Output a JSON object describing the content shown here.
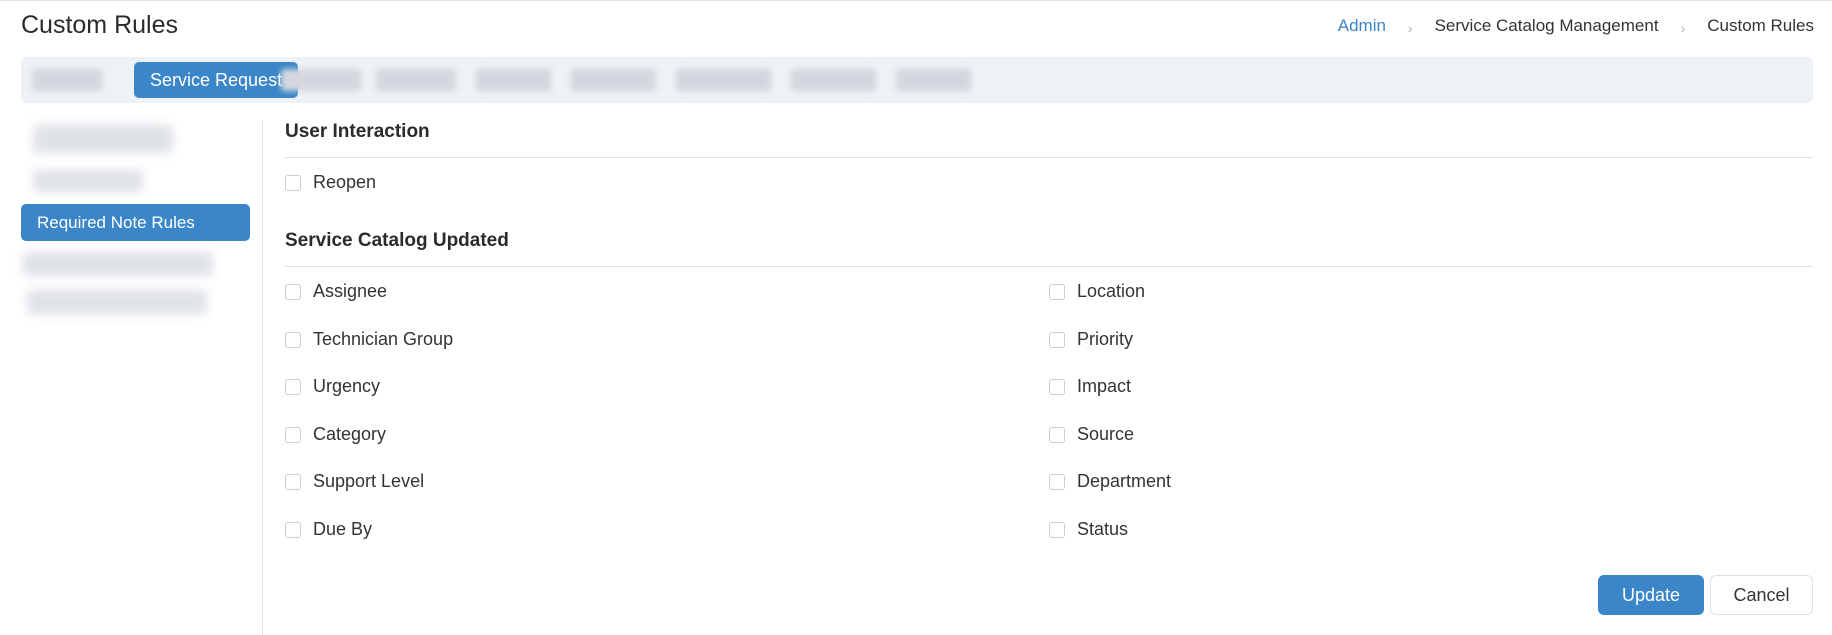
{
  "header": {
    "title": "Custom Rules",
    "breadcrumb": [
      "Admin",
      "Service Catalog Management",
      "Custom Rules"
    ],
    "breadcrumb_separator": "›"
  },
  "tabs": {
    "active_label": "Service Request"
  },
  "sidebar": {
    "active_label": "Required Note Rules"
  },
  "sections": [
    {
      "title": "User Interaction",
      "options": [
        "Reopen"
      ]
    },
    {
      "title": "Service Catalog Updated",
      "left_options": [
        "Assignee",
        "Technician Group",
        "Urgency",
        "Category",
        "Support Level",
        "Due By"
      ],
      "right_options": [
        "Location",
        "Priority",
        "Impact",
        "Source",
        "Department",
        "Status"
      ]
    }
  ],
  "actions": {
    "update_label": "Update",
    "cancel_label": "Cancel"
  },
  "colors": {
    "accent": "#3a86c8",
    "tabbar_bg": "#eef1f5"
  }
}
